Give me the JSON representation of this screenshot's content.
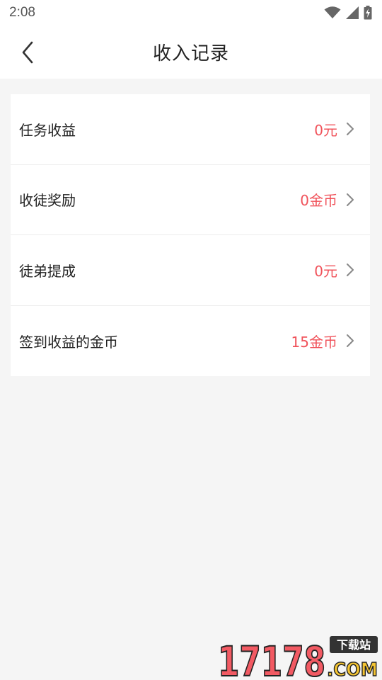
{
  "status_bar": {
    "time": "2:08"
  },
  "header": {
    "title": "收入记录"
  },
  "records": [
    {
      "label": "任务收益",
      "value": "0元"
    },
    {
      "label": "收徒奖励",
      "value": "0金币"
    },
    {
      "label": "徒弟提成",
      "value": "0元"
    },
    {
      "label": "签到收益的金币",
      "value": "15金币"
    }
  ],
  "watermark": {
    "number": "17178",
    "suffix": ".COM",
    "tag": "下载站"
  },
  "colors": {
    "accent": "#f0525a",
    "background": "#f5f5f5",
    "text": "#222222"
  },
  "icons": [
    "wifi-icon",
    "cellular-signal-icon",
    "battery-charging-icon",
    "back-arrow-icon",
    "chevron-right-icon"
  ]
}
